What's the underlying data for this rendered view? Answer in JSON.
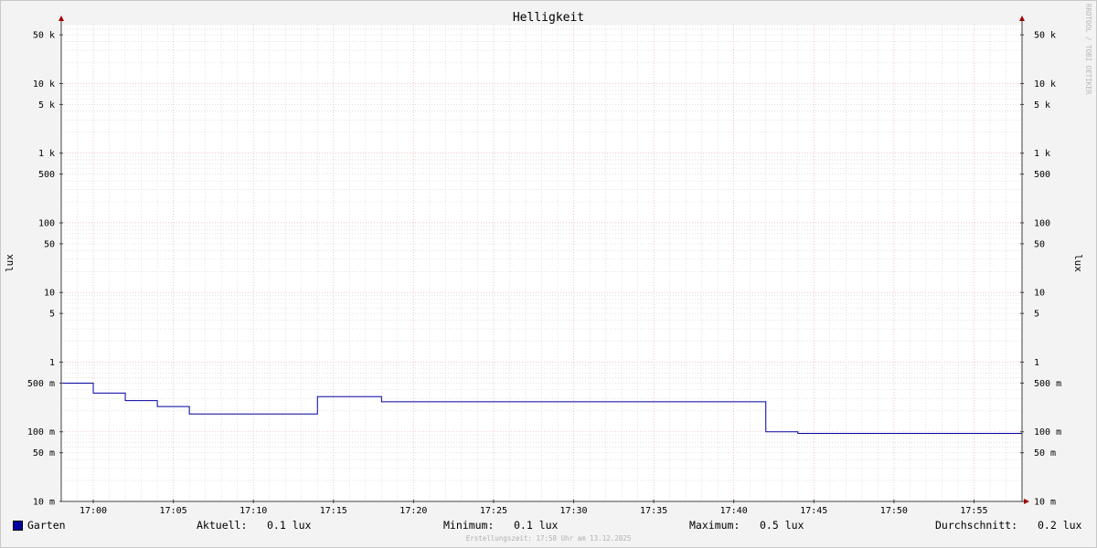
{
  "chart_data": {
    "type": "line",
    "title": "Helligkeit",
    "ylabel": "lux",
    "y_scale": "log",
    "ylim": [
      0.01,
      70000
    ],
    "xlim": [
      "16:58",
      "17:58"
    ],
    "y_ticks": [
      {
        "value": 0.01,
        "label": "10 m"
      },
      {
        "value": 0.05,
        "label": "50 m"
      },
      {
        "value": 0.1,
        "label": "100 m"
      },
      {
        "value": 0.5,
        "label": "500 m"
      },
      {
        "value": 1,
        "label": "1"
      },
      {
        "value": 5,
        "label": "5"
      },
      {
        "value": 10,
        "label": "10"
      },
      {
        "value": 50,
        "label": "50"
      },
      {
        "value": 100,
        "label": "100"
      },
      {
        "value": 500,
        "label": "500"
      },
      {
        "value": 1000,
        "label": "1 k"
      },
      {
        "value": 5000,
        "label": "5 k"
      },
      {
        "value": 10000,
        "label": "10 k"
      },
      {
        "value": 50000,
        "label": "50 k"
      }
    ],
    "x_ticks": [
      "17:00",
      "17:05",
      "17:10",
      "17:15",
      "17:20",
      "17:25",
      "17:30",
      "17:35",
      "17:40",
      "17:45",
      "17:50",
      "17:55"
    ],
    "grid": true,
    "series": [
      {
        "name": "Garten",
        "color": "#0000a0",
        "step": true,
        "x": [
          "16:58",
          "17:00",
          "17:02",
          "17:04",
          "17:06",
          "17:14",
          "17:18",
          "17:42",
          "17:44",
          "17:58"
        ],
        "values": [
          0.5,
          0.36,
          0.28,
          0.23,
          0.18,
          0.32,
          0.27,
          0.1,
          0.095,
          0.095
        ]
      }
    ]
  },
  "colors": {
    "background": "#f3f3f3",
    "canvas": "#ffffff",
    "major_grid": "#e8a0a0",
    "minor_grid": "#d0d0d0",
    "line": "#0000a0",
    "arrow": "#a00000"
  },
  "legend": {
    "series_name": "Garten",
    "current_label": "Aktuell:",
    "current_value": "0.1 lux",
    "min_label": "Minimum:",
    "min_value": "0.1 lux",
    "max_label": "Maximum:",
    "max_value": "0.5 lux",
    "avg_label": "Durchschnitt:",
    "avg_value": "0.2 lux"
  },
  "footer": "Erstellungszeit: 17:58 Uhr am 13.12.2025",
  "watermark": "RRDTOOL / TOBI OETIKER"
}
